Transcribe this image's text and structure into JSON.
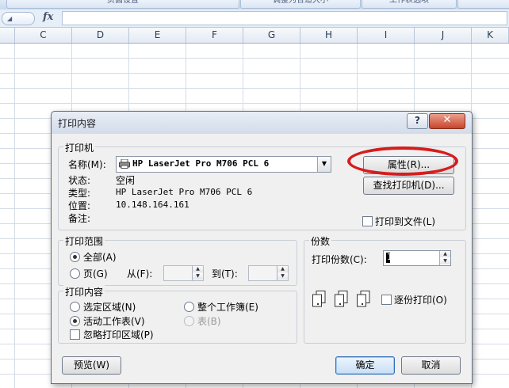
{
  "ribbon": {
    "buttons": [
      "页面设置",
      "调整为合适大小",
      "工作表选项"
    ]
  },
  "formula_bar": {
    "fx": "fx"
  },
  "columns": [
    "C",
    "D",
    "E",
    "F",
    "G",
    "H",
    "I",
    "J",
    "K"
  ],
  "dialog": {
    "title": "打印内容",
    "help_label": "?",
    "close_label": "✕",
    "printer_group": {
      "label": "打印机",
      "name_label": "名称(M):",
      "name_value": "HP LaserJet Pro M706 PCL 6",
      "status_label": "状态:",
      "status_value": "空闲",
      "type_label": "类型:",
      "type_value": "HP LaserJet Pro M706 PCL 6",
      "where_label": "位置:",
      "where_value": "10.148.164.161",
      "comment_label": "备注:",
      "properties_button": "属性(R)...",
      "find_printer_button": "查找打印机(D)...",
      "print_to_file_label": "打印到文件(L)"
    },
    "range_group": {
      "label": "打印范围",
      "all_label": "全部(A)",
      "pages_label": "页(G)",
      "from_label": "从(F):",
      "to_label": "到(T):"
    },
    "copies_group": {
      "label": "份数",
      "copies_label": "打印份数(C):",
      "copies_value": "1",
      "collate_label": "逐份打印(O)"
    },
    "content_group": {
      "label": "打印内容",
      "selection_label": "选定区域(N)",
      "entire_workbook_label": "整个工作簿(E)",
      "active_sheets_label": "活动工作表(V)",
      "table_label": "表(B)",
      "ignore_print_area_label": "忽略打印区域(P)"
    },
    "preview_button": "预览(W)",
    "ok_button": "确定",
    "cancel_button": "取消"
  },
  "colors": {
    "annotation": "#d51d1d",
    "accent": "#2f6fba"
  }
}
